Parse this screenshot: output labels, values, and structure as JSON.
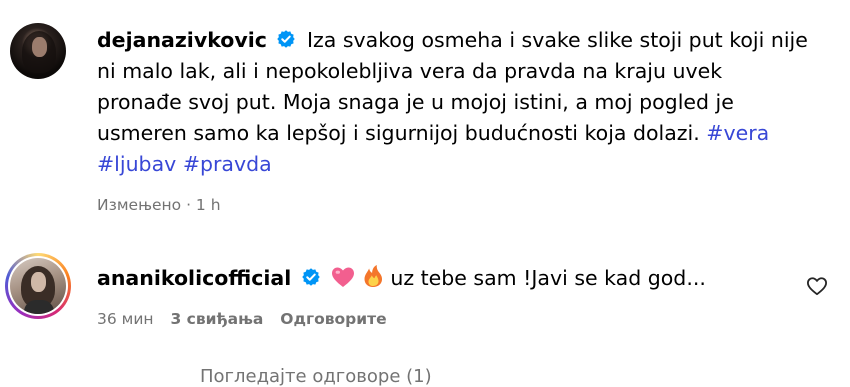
{
  "caption": {
    "username": "dejanazivkovic",
    "text": "Iza svakog osmeha i svake slike stoji put koji nije ni malo lak, ali i nepokolebljiva vera da pravda na kraju uvek pronađe svoj put. Moja snaga je u mojoj istini, a moj pogled je usmeren samo ka lepšoj i sigurnijoj budućnosti koja dolazi.",
    "hashtags": [
      "#vera",
      "#ljubav",
      "#pravda"
    ],
    "meta": "Измењено · 1 h"
  },
  "comment": {
    "username": "ananikolicofficial",
    "text": "uz tebe sam !Javi se kad god...",
    "time": "36 мин",
    "likes": "3 свиђања",
    "reply": "Одговорите"
  },
  "partial_text": "Погледајте одговоре (1)",
  "icons": {
    "verified": "verified-badge-icon",
    "heart_emoji": "pink-heart-emoji",
    "fire_emoji": "fire-emoji",
    "like": "heart-outline-icon"
  },
  "colors": {
    "hashtag": "#3847d6",
    "verified": "#0095f6",
    "meta": "#737373"
  }
}
